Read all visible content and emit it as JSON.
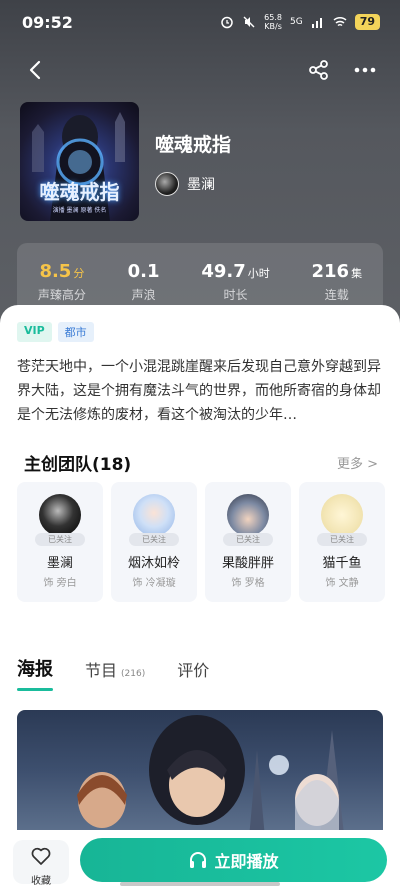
{
  "status_bar": {
    "time": "09:52",
    "net_speed_value": "65.8",
    "net_speed_unit": "KB/s",
    "network": "5G",
    "battery": "79"
  },
  "nav": {
    "back_icon": "chevron-left-icon",
    "share_icon": "share-icon",
    "more_icon": "more-dots-icon"
  },
  "book": {
    "cover_title": "噬魂戒指",
    "cover_sub": "演播 墨澜   原著 佚名",
    "title": "噬魂戒指",
    "author": "墨澜"
  },
  "stats": [
    {
      "value": "8.5",
      "unit": "分",
      "label": "声臻高分"
    },
    {
      "value": "0.1",
      "unit": "",
      "label": "声浪"
    },
    {
      "value": "49.7",
      "unit": "小时",
      "label": "时长"
    },
    {
      "value": "216",
      "unit": "集",
      "label": "连载"
    }
  ],
  "tags": [
    "VIP",
    "都市"
  ],
  "description": "苍茫天地中，一个小混混跳崖醒来后发现自己意外穿越到异界大陆，这是个拥有魔法斗气的世界，而他所寄宿的身体却是个无法修炼的废材，看这个被淘汰的少年…",
  "team": {
    "title": "主创团队(18)",
    "more": "更多 >",
    "members": [
      {
        "name": "墨澜",
        "role": "饰 旁白",
        "follow": "已关注"
      },
      {
        "name": "烟沐如柃",
        "role": "饰 冷凝璇",
        "follow": "已关注"
      },
      {
        "name": "果酸胖胖",
        "role": "饰 罗格",
        "follow": "已关注"
      },
      {
        "name": "猫千鱼",
        "role": "饰 文静",
        "follow": "已关注"
      }
    ]
  },
  "tabs": {
    "poster": "海报",
    "episodes": "节目",
    "episodes_count": "(216)",
    "reviews": "评价"
  },
  "bottom": {
    "favorite": "收藏",
    "play": "立即播放"
  },
  "colors": {
    "accent": "#1abc9c",
    "rating_gold": "#f6c449"
  }
}
